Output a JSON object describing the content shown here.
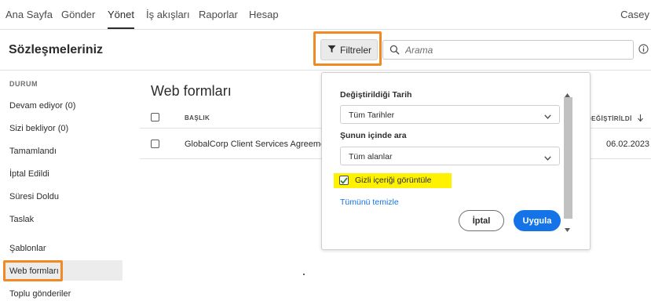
{
  "nav": {
    "items": [
      "Ana Sayfa",
      "Gönder",
      "Yönet",
      "İş akışları",
      "Raporlar",
      "Hesap"
    ],
    "active": "Yönet",
    "user": "Casey"
  },
  "header": {
    "title": "Sözleşmeleriniz",
    "filter_label": "Filtreler",
    "search_placeholder": "Arama"
  },
  "sidebar": {
    "heading": "DURUM",
    "status_items": [
      "Devam ediyor (0)",
      "Sizi bekliyor (0)",
      "Tamamlandı",
      "İptal Edildi",
      "Süresi Doldu",
      "Taslak"
    ],
    "section_items": [
      "Şablonlar",
      "Web formları",
      "Toplu gönderiler"
    ],
    "active": "Web formları"
  },
  "main": {
    "title": "Web formları",
    "columns": {
      "title": "BAŞLIK",
      "modified": "DEĞİŞTİRİLDİ"
    },
    "rows": [
      {
        "title": "GlobalCorp Client Services Agreement",
        "modified": "06.02.2023"
      }
    ]
  },
  "filter_panel": {
    "date_label": "Değiştirildiği Tarih",
    "date_value": "Tüm Tarihler",
    "search_in_label": "Şunun içinde ara",
    "search_in_value": "Tüm alanlar",
    "show_hidden_label": "Gizli içeriği görüntüle",
    "show_hidden_checked": true,
    "clear_all": "Tümünü temizle",
    "cancel": "İptal",
    "apply": "Uygula"
  },
  "colors": {
    "accent_blue": "#1473e6",
    "highlight_orange": "#f08a24",
    "highlight_yellow": "#fff200"
  }
}
